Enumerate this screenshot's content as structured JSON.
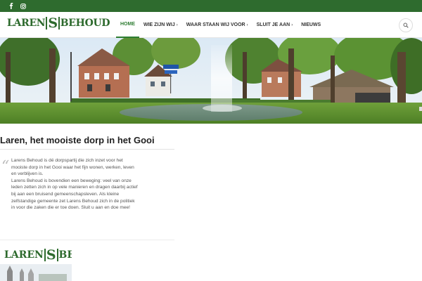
{
  "topbar": {
    "bg": "#2e6b2e",
    "icons": [
      "facebook-icon",
      "instagram-icon"
    ]
  },
  "header": {
    "logo_left": "LAREN",
    "logo_mid": "S",
    "logo_right": "BEHOUD",
    "brand_color": "#2d6a2d",
    "nav": [
      {
        "label": "HOME",
        "active": true,
        "caret": ""
      },
      {
        "label": "WIE ZIJN WIJ",
        "active": false,
        "caret": "›"
      },
      {
        "label": "WAAR STAAN WIJ VOOR",
        "active": false,
        "caret": "›"
      },
      {
        "label": "SLUIT JE AAN",
        "active": false,
        "caret": "›"
      },
      {
        "label": "NIEUWS",
        "active": false,
        "caret": ""
      }
    ],
    "accent": "#2e7d32"
  },
  "main": {
    "title": "Laren, het mooiste dorp in het Gooi",
    "paragraph1": "Larens Behoud is dé dorpspartij die zich inzet voor het mooiste dorp in het Gooi waar het fijn wonen, werken, leven en verblijven is.",
    "paragraph2": "Larens Behoud is bovendien een beweging: veel van onze leden zetten zich in op vele manieren en dragen daarbij actief bij aan een bruisend gemeenschapsleven. Als kleine zelfstandige gemeente zet Larens Behoud zich in de politiek in voor die zaken die er toe doen. Sluit u aan en doe mee!"
  },
  "footer_logo": {
    "left": "LAREN",
    "mid": "S",
    "right": "BEHOUD"
  }
}
